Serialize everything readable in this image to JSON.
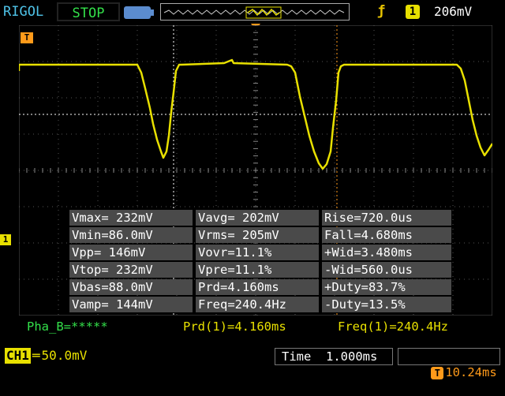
{
  "header": {
    "brand": "RIGOL",
    "run_state": "STOP",
    "trigger_channel": "1",
    "trigger_level": "206mV"
  },
  "markers": {
    "trigger_ref": "T",
    "channel_ref": "1"
  },
  "measurements": {
    "rows": [
      [
        "Vmax= 232mV",
        "Vavg= 202mV",
        "Rise=720.0us"
      ],
      [
        "Vmin=86.0mV",
        "Vrms= 205mV",
        "Fall=4.680ms"
      ],
      [
        "Vpp= 146mV",
        "Vovr=11.1%",
        "+Wid=3.480ms"
      ],
      [
        "Vtop= 232mV",
        "Vpre=11.1%",
        "-Wid=560.0us"
      ],
      [
        "Vbas=88.0mV",
        "Prd=4.160ms",
        "+Duty=83.7%"
      ],
      [
        "Vamp= 144mV",
        "Freq=240.4Hz",
        "-Duty=13.5%"
      ]
    ]
  },
  "info": {
    "phase": "Pha_B=*****",
    "period": "Prd(1)=4.160ms",
    "frequency": "Freq(1)=240.4Hz"
  },
  "footer": {
    "channel": "CH1",
    "coupling_icon": "dc-coupling-icon",
    "vertical_scale": "50.0mV",
    "timebase": "Time  1.000ms",
    "trigger_delay": "10.24ms"
  },
  "colors": {
    "trace": "#e8e000",
    "brand": "#4fc3e8",
    "run": "#33e04a",
    "trigger": "#ff9a1a"
  }
}
